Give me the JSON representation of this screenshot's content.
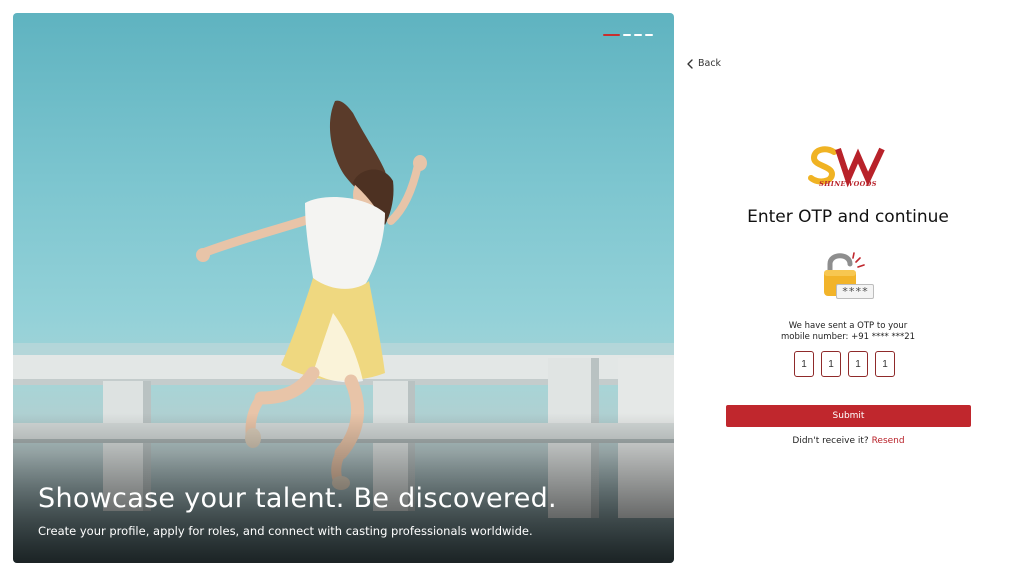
{
  "hero": {
    "title": "Showcase your talent. Be discovered.",
    "subtitle": "Create your profile, apply for roles, and connect with casting professionals worldwide.",
    "carousel": {
      "total": 4,
      "active_index": 0
    }
  },
  "nav": {
    "back_label": "Back"
  },
  "brand": {
    "logo_letters": "SW",
    "logo_text": "SHINEWOODS",
    "colors": {
      "primary": "#c0272d",
      "accent": "#f0b323"
    }
  },
  "otp": {
    "heading": "Enter OTP and continue",
    "mask": "****",
    "message_line1": "We have sent a OTP to your",
    "message_line2": "mobile number: +91 **** ***21",
    "digits": [
      "1",
      "1",
      "1",
      "1"
    ],
    "submit_label": "Submit",
    "resend_prompt": "Didn't  receive it?",
    "resend_label": "Resend"
  }
}
